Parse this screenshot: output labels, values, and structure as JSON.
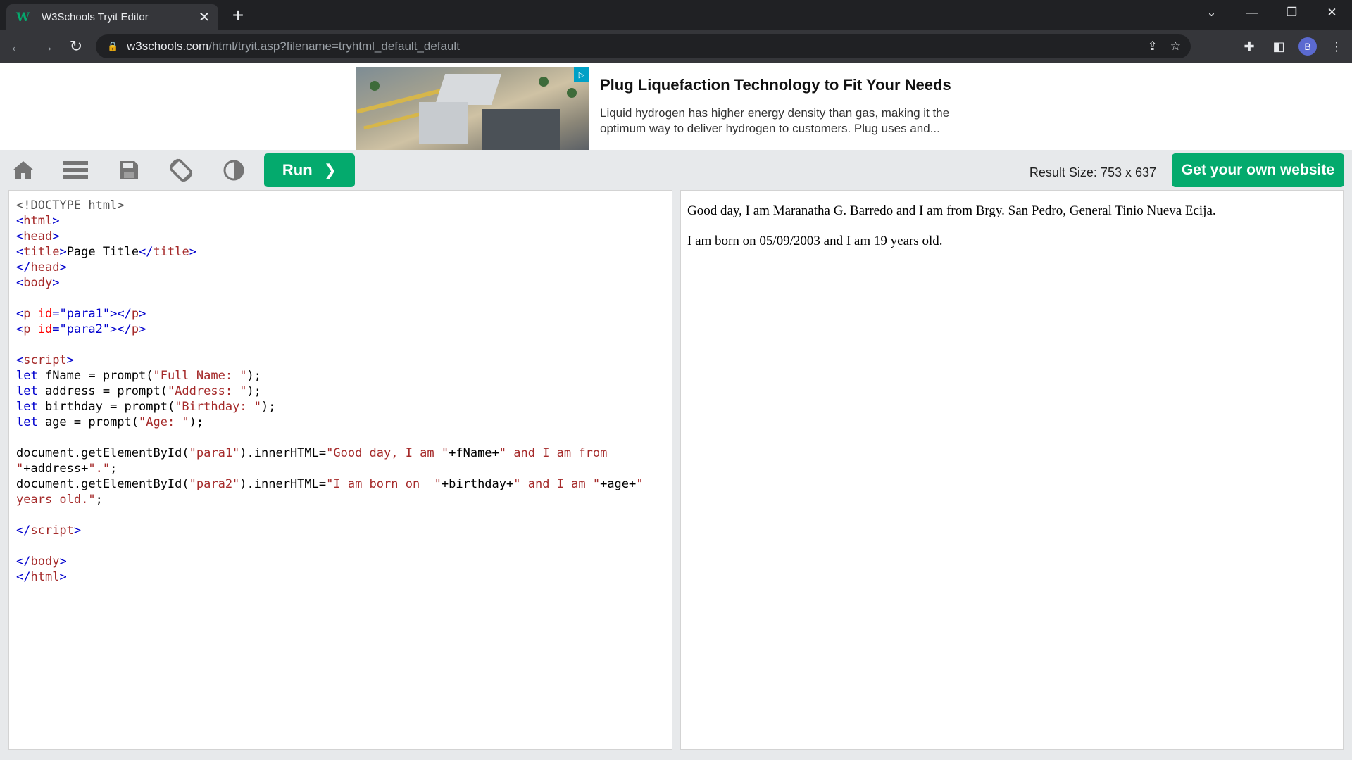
{
  "browser": {
    "tab_title": "W3Schools Tryit Editor",
    "tab_favicon": "W",
    "url_host": "w3schools.com",
    "url_path": "/html/tryit.asp?filename=tryhtml_default_default",
    "profile_initial": "B"
  },
  "ad": {
    "title": "Plug Liquefaction Technology to Fit Your Needs",
    "description": "Liquid hydrogen has higher energy density than gas, making it the optimum way to deliver hydrogen to customers. Plug uses and..."
  },
  "editor_toolbar": {
    "run_label": "Run",
    "run_chevron": "❯",
    "result_size": "Result Size: 753 x 637",
    "get_site_label": "Get your own website"
  },
  "code_lines": [
    [
      {
        "t": "<!DOCTYPE html>",
        "c": "doc"
      }
    ],
    [
      {
        "t": "<",
        "c": "tag"
      },
      {
        "t": "html",
        "c": "name"
      },
      {
        "t": ">",
        "c": "tag"
      }
    ],
    [
      {
        "t": "<",
        "c": "tag"
      },
      {
        "t": "head",
        "c": "name"
      },
      {
        "t": ">",
        "c": "tag"
      }
    ],
    [
      {
        "t": "<",
        "c": "tag"
      },
      {
        "t": "title",
        "c": "name"
      },
      {
        "t": ">",
        "c": "tag"
      },
      {
        "t": "Page Title",
        "c": "plain"
      },
      {
        "t": "</",
        "c": "tag"
      },
      {
        "t": "title",
        "c": "name"
      },
      {
        "t": ">",
        "c": "tag"
      }
    ],
    [
      {
        "t": "</",
        "c": "tag"
      },
      {
        "t": "head",
        "c": "name"
      },
      {
        "t": ">",
        "c": "tag"
      }
    ],
    [
      {
        "t": "<",
        "c": "tag"
      },
      {
        "t": "body",
        "c": "name"
      },
      {
        "t": ">",
        "c": "tag"
      }
    ],
    [],
    [
      {
        "t": "<",
        "c": "tag"
      },
      {
        "t": "p",
        "c": "name"
      },
      {
        "t": " id",
        "c": "attr"
      },
      {
        "t": "=\"para1\"",
        "c": "val"
      },
      {
        "t": "></",
        "c": "tag"
      },
      {
        "t": "p",
        "c": "name"
      },
      {
        "t": ">",
        "c": "tag"
      }
    ],
    [
      {
        "t": "<",
        "c": "tag"
      },
      {
        "t": "p",
        "c": "name"
      },
      {
        "t": " id",
        "c": "attr"
      },
      {
        "t": "=\"para2\"",
        "c": "val"
      },
      {
        "t": "></",
        "c": "tag"
      },
      {
        "t": "p",
        "c": "name"
      },
      {
        "t": ">",
        "c": "tag"
      }
    ],
    [],
    [
      {
        "t": "<",
        "c": "tag"
      },
      {
        "t": "script",
        "c": "name"
      },
      {
        "t": ">",
        "c": "tag"
      }
    ],
    [
      {
        "t": "let",
        "c": "kw"
      },
      {
        "t": " fName = prompt(",
        "c": "plain"
      },
      {
        "t": "\"Full Name: \"",
        "c": "str"
      },
      {
        "t": ");",
        "c": "plain"
      }
    ],
    [
      {
        "t": "let",
        "c": "kw"
      },
      {
        "t": " address = prompt(",
        "c": "plain"
      },
      {
        "t": "\"Address: \"",
        "c": "str"
      },
      {
        "t": ");",
        "c": "plain"
      }
    ],
    [
      {
        "t": "let",
        "c": "kw"
      },
      {
        "t": " birthday = prompt(",
        "c": "plain"
      },
      {
        "t": "\"Birthday: \"",
        "c": "str"
      },
      {
        "t": ");",
        "c": "plain"
      }
    ],
    [
      {
        "t": "let",
        "c": "kw"
      },
      {
        "t": " age = prompt(",
        "c": "plain"
      },
      {
        "t": "\"Age: \"",
        "c": "str"
      },
      {
        "t": ");",
        "c": "plain"
      }
    ],
    [],
    [
      {
        "t": "document.getElementById(",
        "c": "plain"
      },
      {
        "t": "\"para1\"",
        "c": "str"
      },
      {
        "t": ").innerHTML=",
        "c": "plain"
      },
      {
        "t": "\"Good day, I am \"",
        "c": "str"
      },
      {
        "t": "+fName+",
        "c": "plain"
      },
      {
        "t": "\" and I am from",
        "c": "str"
      }
    ],
    [
      {
        "t": "\"",
        "c": "str"
      },
      {
        "t": "+address+",
        "c": "plain"
      },
      {
        "t": "\".\"",
        "c": "str"
      },
      {
        "t": ";",
        "c": "plain"
      }
    ],
    [
      {
        "t": "document.getElementById(",
        "c": "plain"
      },
      {
        "t": "\"para2\"",
        "c": "str"
      },
      {
        "t": ").innerHTML=",
        "c": "plain"
      },
      {
        "t": "\"I am born on  \"",
        "c": "str"
      },
      {
        "t": "+birthday+",
        "c": "plain"
      },
      {
        "t": "\" and I am \"",
        "c": "str"
      },
      {
        "t": "+age+",
        "c": "plain"
      },
      {
        "t": "\"",
        "c": "str"
      }
    ],
    [
      {
        "t": "years old.\"",
        "c": "str"
      },
      {
        "t": ";",
        "c": "plain"
      }
    ],
    [],
    [
      {
        "t": "</",
        "c": "tag"
      },
      {
        "t": "script",
        "c": "name"
      },
      {
        "t": ">",
        "c": "tag"
      }
    ],
    [],
    [
      {
        "t": "</",
        "c": "tag"
      },
      {
        "t": "body",
        "c": "name"
      },
      {
        "t": ">",
        "c": "tag"
      }
    ],
    [
      {
        "t": "</",
        "c": "tag"
      },
      {
        "t": "html",
        "c": "name"
      },
      {
        "t": ">",
        "c": "tag"
      }
    ]
  ],
  "result": {
    "para1": "Good day, I am Maranatha G. Barredo and I am from Brgy. San Pedro, General Tinio Nueva Ecija.",
    "para2": "I am born on 05/09/2003 and I am 19 years old."
  },
  "colors": {
    "accent_green": "#04aa6d",
    "chrome_dark": "#202124",
    "chrome_mid": "#35363a"
  }
}
